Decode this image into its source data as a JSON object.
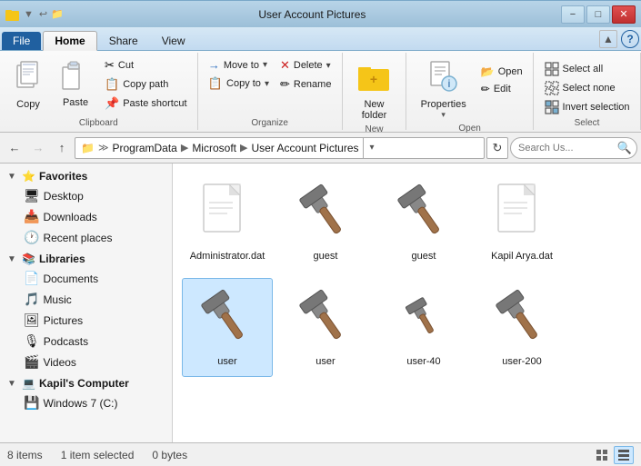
{
  "window": {
    "title": "User Account Pictures",
    "controls": {
      "minimize": "−",
      "maximize": "□",
      "close": "✕"
    }
  },
  "ribbon": {
    "tabs": [
      {
        "id": "file",
        "label": "File"
      },
      {
        "id": "home",
        "label": "Home",
        "active": true
      },
      {
        "id": "share",
        "label": "Share"
      },
      {
        "id": "view",
        "label": "View"
      }
    ],
    "groups": {
      "clipboard": {
        "label": "Clipboard",
        "copy_label": "Copy",
        "paste_label": "Paste",
        "cut_label": "Cut",
        "copy_path_label": "Copy path",
        "paste_shortcut_label": "Paste shortcut"
      },
      "organize": {
        "label": "Organize",
        "move_to_label": "Move to",
        "copy_to_label": "Copy to",
        "delete_label": "Delete",
        "rename_label": "Rename"
      },
      "new": {
        "label": "New",
        "new_folder_label": "New\nfolder"
      },
      "open": {
        "label": "Open",
        "properties_label": "Properties"
      },
      "select": {
        "label": "Select",
        "select_all_label": "Select all",
        "select_none_label": "Select none",
        "invert_label": "Invert selection"
      }
    }
  },
  "addressbar": {
    "back_tooltip": "Back",
    "forward_tooltip": "Forward",
    "up_tooltip": "Up",
    "path": [
      "ProgramData",
      "Microsoft",
      "User Account Pictures"
    ],
    "search_placeholder": "Search Us..."
  },
  "sidebar": {
    "sections": [
      {
        "id": "favorites",
        "label": "Favorites",
        "icon": "⭐",
        "expanded": true,
        "items": [
          {
            "id": "desktop",
            "label": "Desktop",
            "icon": "🖥"
          },
          {
            "id": "downloads",
            "label": "Downloads",
            "icon": "📥"
          },
          {
            "id": "recent",
            "label": "Recent places",
            "icon": "🕐"
          }
        ]
      },
      {
        "id": "libraries",
        "label": "Libraries",
        "icon": "📚",
        "expanded": true,
        "items": [
          {
            "id": "documents",
            "label": "Documents",
            "icon": "📄"
          },
          {
            "id": "music",
            "label": "Music",
            "icon": "🎵"
          },
          {
            "id": "pictures",
            "label": "Pictures",
            "icon": "🖼"
          },
          {
            "id": "podcasts",
            "label": "Podcasts",
            "icon": "🎙"
          },
          {
            "id": "videos",
            "label": "Videos",
            "icon": "🎬"
          }
        ]
      },
      {
        "id": "computer",
        "label": "Kapil's Computer",
        "icon": "💻",
        "expanded": true,
        "items": [
          {
            "id": "windows7",
            "label": "Windows 7 (C:)",
            "icon": "💾"
          }
        ]
      }
    ]
  },
  "files": [
    {
      "id": "administrator",
      "label": "Administrator.dat",
      "type": "document",
      "selected": false
    },
    {
      "id": "guest1",
      "label": "guest",
      "type": "hammer",
      "selected": false
    },
    {
      "id": "guest2",
      "label": "guest",
      "type": "hammer",
      "selected": false
    },
    {
      "id": "kapil",
      "label": "Kapil Arya.dat",
      "type": "document",
      "selected": false
    },
    {
      "id": "user1",
      "label": "user",
      "type": "hammer",
      "selected": true
    },
    {
      "id": "user2",
      "label": "user",
      "type": "hammer",
      "selected": false
    },
    {
      "id": "user40",
      "label": "user-40",
      "type": "hammer-small",
      "selected": false
    },
    {
      "id": "user200",
      "label": "user-200",
      "type": "hammer",
      "selected": false
    }
  ],
  "statusbar": {
    "item_count": "8 items",
    "selected_count": "1 item selected",
    "selected_size": "0 bytes"
  }
}
